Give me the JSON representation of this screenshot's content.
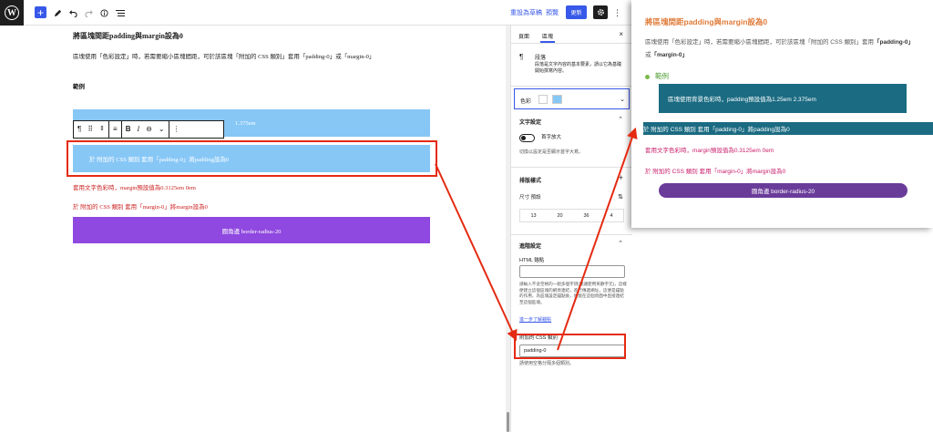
{
  "topbar": {
    "logo": "W",
    "add_label": "+",
    "save_draft_label": "重設為草稿",
    "preview_label": "預覽",
    "publish_label": "更新",
    "settings_icon": "gear-icon",
    "more_icon": "⋮"
  },
  "editor": {
    "heading": "將區塊間距padding與margin設為0",
    "intro": "區塊使用「色彩設定」時，若需要縮小區塊間距，可於該區塊「附加的 CSS 類別」套用「padding-0」或「margin-0」",
    "example_label": "範例",
    "block1_text": "1.375em",
    "block2_text": "於 附加的 CSS 類別 套用「padding-0」將padding設為0",
    "red_text_1": "套用文字色彩時，margin預設值為0.3125em 0em",
    "red_text_2": "於 附加的 CSS 類別 套用「margin-0」將margin設為0",
    "purple_text": "圓角邊 border-radius-20",
    "colors": {
      "lightblue": "#87c7f6",
      "purple": "#8f48e0",
      "red": "#cc2222"
    }
  },
  "sidebar": {
    "tabs": [
      "頁面",
      "區塊"
    ],
    "active_tab": "區塊",
    "close_icon": "×",
    "paragraph_title": "段落",
    "paragraph_desc": "段落是文字內容的基本要素，請以它為基礎開始撰寫內容。",
    "color_label": "色彩",
    "text_settings_title": "文字設定",
    "drop_cap_label": "首字放大",
    "drop_cap_help": "切換以設定是否顯示首字大寫。",
    "typography_title": "排版樣式",
    "size_label": "尺寸 預設",
    "sizes": [
      "13",
      "20",
      "36",
      "4"
    ],
    "advanced_title": "進階設定",
    "html_anchor_label": "HTML 錨點",
    "html_anchor_help": "請輸入不含空格的一組多個字詞(建議使用英數字元)，這樣便建立這個區塊的網頁連結，進行傳遞網址，這便是錨點的作用，為區塊設定錨點後，便能在這個頁面中直接連結至這個區塊。",
    "anchor_link": "進一步了解錨點",
    "css_class_label": "附加的 CSS 類別",
    "css_class_value": "padding-0",
    "css_class_help": "請使用空格分隔多個類別。"
  },
  "preview": {
    "heading": "將區塊間距padding與margin設為0",
    "intro_prefix": "區塊使用「色彩設定」時，若需要縮小區塊間距，可於該區塊「附加的 CSS 類別」套用",
    "intro_pad": "「padding-0」",
    "intro_or": "或",
    "intro_margin": "「margin-0」",
    "example_label": "範例",
    "teal_block_text": "區塊使用背景色彩時，padding預設值為1.25em 2.375em",
    "teal_full_text": "於 附加的 CSS 類別 套用「padding-0」將padding設為0",
    "red_text_1": "套用文字色彩時，margin預設值為0.3125em 0em",
    "red_text_2": "於 附加的 CSS 類別 套用「margin-0」將margin設為0",
    "purple_text": "圓角邊 border-radius-20",
    "colors": {
      "heading": "#e07b39",
      "teal": "#1b6b82",
      "magenta": "#c81d6a",
      "purple": "#6a3c9a",
      "green": "#4a9a2c"
    }
  },
  "annotation": {
    "color": "#e52a12"
  }
}
